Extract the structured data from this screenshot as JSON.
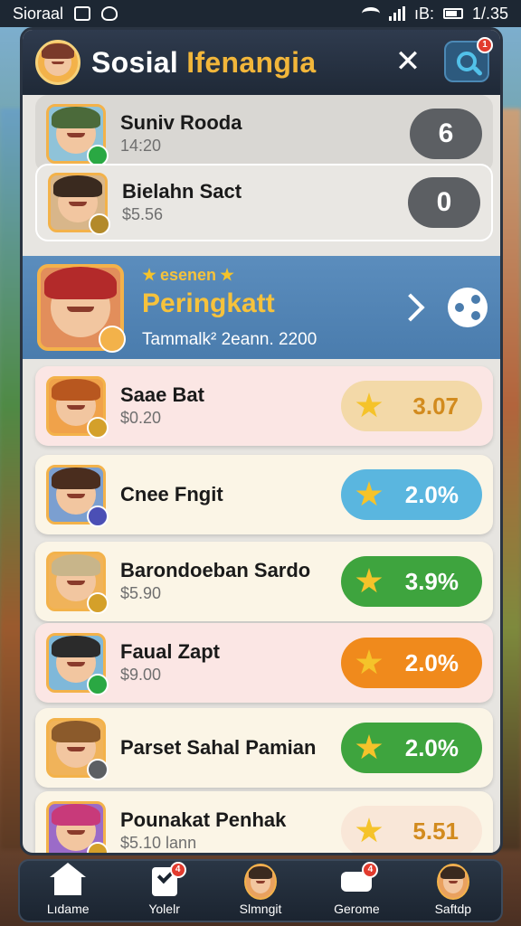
{
  "status_bar": {
    "carrier": "Sioraal",
    "right_text": "ıB:",
    "time": "1/.35"
  },
  "header": {
    "title_part1": "Sosial",
    "title_part2": "Ifenangia",
    "close_glyph": "✕",
    "search_badge": "1"
  },
  "top_rows": [
    {
      "name": "Suniv Rooda",
      "sub": "14:20",
      "count": "6",
      "mini_color": "#2aa843",
      "hair": "#4b6a3a",
      "bg": "#8fc3d9"
    },
    {
      "name": "Bielahn Sact",
      "sub": "$5.56",
      "count": "0",
      "mini_color": "#b38a2a",
      "hair": "#3a2a1f",
      "bg": "#d8b68a"
    }
  ],
  "featured": {
    "tag": "esenen",
    "title": "Peringkatt",
    "subtitle": "Tammalk² 2eann. 2200"
  },
  "leaderboard": [
    {
      "name": "Saae Bat",
      "sub": "$0.20",
      "score": "3.07",
      "pill_color": "#f3d9a8",
      "score_color": "#d28b1e",
      "row_bg": "#fbe6e4",
      "hair": "#b8571f",
      "bg": "#f0a24a",
      "mini_color": "#d4a02a"
    },
    {
      "name": "Cnee Fngit",
      "sub": "",
      "score": "2.0%",
      "pill_color": "#5ab6df",
      "score_color": "#ffffff",
      "row_bg": "#fbf5e6",
      "hair": "#4a2d1e",
      "bg": "#7b9fd0",
      "mini_color": "#4b4fb5"
    },
    {
      "name": "Barondoeban Sardo",
      "sub": "$5.90",
      "score": "3.9%",
      "pill_color": "#3ea43e",
      "score_color": "#ffffff",
      "row_bg": "#fbf5e6",
      "hair": "#c8b58a",
      "bg": "#f0b35a",
      "mini_color": "#d4a02a"
    },
    {
      "name": "Faual Zapt",
      "sub": "$9.00",
      "score": "2.0%",
      "pill_color": "#f08a1c",
      "score_color": "#ffffff",
      "row_bg": "#fbe6e4",
      "hair": "#2b2b2b",
      "bg": "#7fb8d9",
      "mini_color": "#2aa843"
    },
    {
      "name": "Parset Sahal Pamian",
      "sub": "",
      "score": "2.0%",
      "pill_color": "#3ea43e",
      "score_color": "#ffffff",
      "row_bg": "#fbf5e6",
      "hair": "#8b5a2b",
      "bg": "#f0b35a",
      "mini_color": "#5c5f63"
    },
    {
      "name": "Pounakat Penhak",
      "sub": "$5.10 lann",
      "score": "5.51",
      "pill_color": "#f9e7d8",
      "score_color": "#d28b1e",
      "row_bg": "#fbf5e6",
      "hair": "#c83a7a",
      "bg": "#9b6bc8",
      "mini_color": "#d4a02a"
    }
  ],
  "bottom_nav": [
    {
      "label": "Lıdame",
      "icon": "home-icon"
    },
    {
      "label": "Yolelr",
      "icon": "document-icon",
      "badge": "4"
    },
    {
      "label": "Slmngit",
      "icon": "avatar-icon"
    },
    {
      "label": "Gerome",
      "icon": "game-icon",
      "badge": "4"
    },
    {
      "label": "Saftdp",
      "icon": "profile-icon"
    }
  ]
}
